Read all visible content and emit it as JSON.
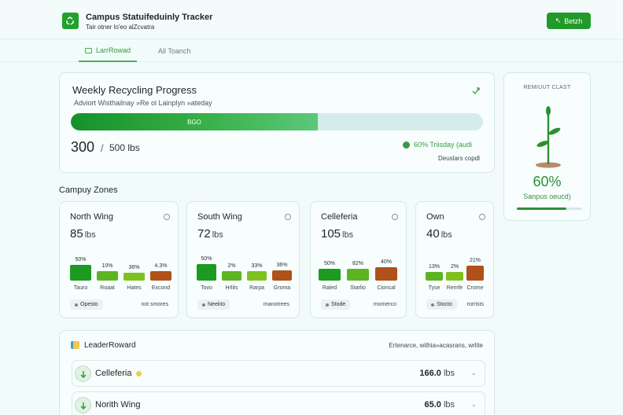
{
  "header": {
    "title": "Campus Statuifeduinly Tracker",
    "subtitle": "Tair otner lo'eo alZcvatra",
    "action_label": "Betzh"
  },
  "tabs": [
    {
      "label": "LarrRowad",
      "active": true
    },
    {
      "label": "All Toanch",
      "active": false
    }
  ],
  "progress": {
    "title": "Weekly Recycling Progress",
    "subtitle": "Adviort Wisthailnay »Re ol Lainplyn »ateday",
    "current": "300",
    "goal": "500 lbs",
    "fraction": 0.6,
    "bar_label": "BGO",
    "percent_text": "60% Triisday (audi",
    "footer": "Deuslars copdl"
  },
  "side": {
    "title": "REMIUUT CLAST",
    "percent": "60%",
    "label": "Sanpus oeucd)",
    "fraction": 0.76
  },
  "zones_title": "Campuy Zones",
  "zones": [
    {
      "name": "North Wing",
      "weight": "85",
      "unit": "lbs",
      "bars": [
        {
          "label": "50%",
          "cat": "Tauro",
          "level": 0.62,
          "color": "#1d9a22"
        },
        {
          "label": "10%",
          "cat": "Roaat",
          "level": 0.38,
          "color": "#5cb423"
        },
        {
          "label": "36%",
          "cat": "Hates",
          "level": 0.32,
          "color": "#7ec11e"
        },
        {
          "label": "4.3%",
          "cat": "Excond",
          "level": 0.38,
          "color": "#b0501a"
        }
      ],
      "tag": "Opesto",
      "note": "not smores"
    },
    {
      "name": "South Wing",
      "weight": "72",
      "unit": "lbs",
      "bars": [
        {
          "label": "50%",
          "cat": "Tovo",
          "level": 0.65,
          "color": "#1d9a22"
        },
        {
          "label": "2%",
          "cat": "Hrlits",
          "level": 0.38,
          "color": "#5cb423"
        },
        {
          "label": "33%",
          "cat": "Rarpa",
          "level": 0.38,
          "color": "#7ec11e"
        },
        {
          "label": "36%",
          "cat": "Groma",
          "level": 0.42,
          "color": "#b0501a"
        }
      ],
      "tag": "Neekto",
      "note": "manotrees"
    },
    {
      "name": "Celleferia",
      "weight": "105",
      "unit": "lbs",
      "bars": [
        {
          "label": "50%",
          "cat": "Raled",
          "level": 0.48,
          "color": "#1d9a22"
        },
        {
          "label": "82%",
          "cat": "Starlio",
          "level": 0.48,
          "color": "#5cb423"
        },
        {
          "label": "40%",
          "cat": "Cioncal",
          "level": 0.52,
          "color": "#b0501a"
        }
      ],
      "tag": "Stode",
      "note": "momerco"
    },
    {
      "name": "Own",
      "weight": "40",
      "unit": "lbs",
      "bars": [
        {
          "label": "13%",
          "cat": "Tyse",
          "level": 0.35,
          "color": "#5cb423"
        },
        {
          "label": "2%",
          "cat": "Remfe",
          "level": 0.35,
          "color": "#7ec11e"
        },
        {
          "label": "21%",
          "cat": "Crome",
          "level": 0.6,
          "color": "#b0501a"
        }
      ],
      "tag": "Stocto",
      "note": "rorrists"
    }
  ],
  "leaderboard": {
    "title": "LeaderRoward",
    "note": "Ertenarce, withia»acasrans, wrlite",
    "rows": [
      {
        "name": "Celleferia",
        "value": "166.0",
        "unit": "lbs",
        "badge": true
      },
      {
        "name": "Norith Wing",
        "value": "65.0",
        "unit": "lbs",
        "badge": false
      }
    ]
  }
}
